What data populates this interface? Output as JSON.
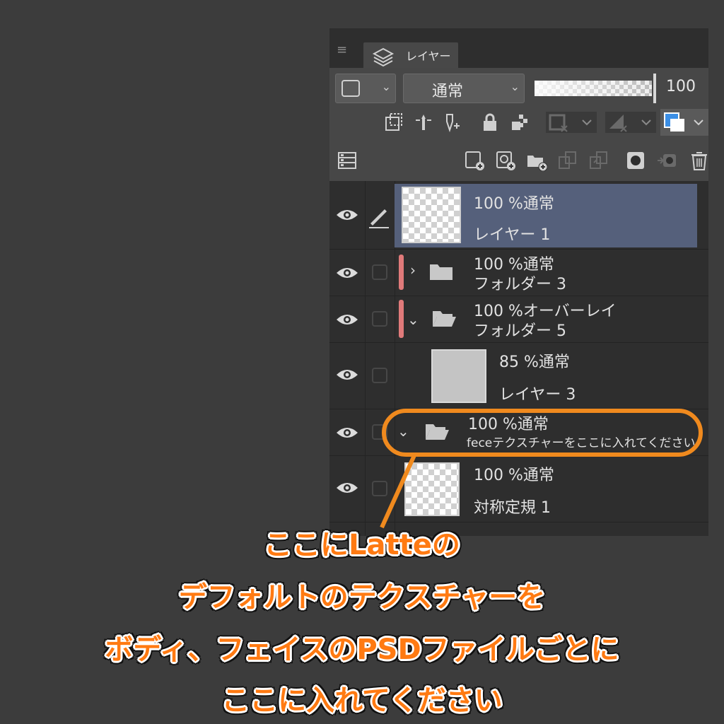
{
  "panel": {
    "tab_label": "レイヤー",
    "blend_mode": "通常",
    "opacity": "100"
  },
  "layers": [
    {
      "opacity_mode": "100 %通常",
      "name": "レイヤー 1"
    },
    {
      "opacity_mode": "100 %通常",
      "name": "フォルダー 3"
    },
    {
      "opacity_mode": "100 %オーバーレイ",
      "name": "フォルダー 5"
    },
    {
      "opacity_mode": "85 %通常",
      "name": "レイヤー 3"
    },
    {
      "opacity_mode": "100 %通常",
      "name": "feceテクスチャーをここに入れてください"
    },
    {
      "opacity_mode": "100 %通常",
      "name": "対称定規 1"
    }
  ],
  "annotation": {
    "line1": "ここにLatteの",
    "line2": "デフォルトのテクスチャーを",
    "line3": "ボディ、フェイスのPSDファイルごとに",
    "line4": "ここに入れてください"
  },
  "colors": {
    "highlight": "#f08a1e",
    "caption": "#ff7a12",
    "folder_bar": "#e07a7a",
    "selected_row": "#55607b"
  }
}
